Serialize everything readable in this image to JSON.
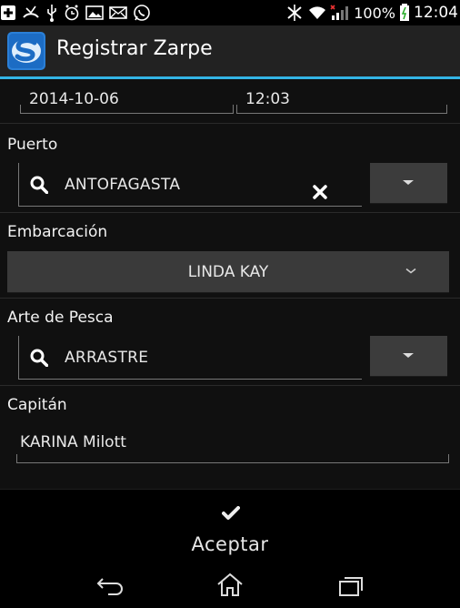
{
  "status_bar": {
    "battery_percent": "100%",
    "time": "12:04",
    "icons": [
      "app-notification-icon",
      "missed-call-icon",
      "usb-icon",
      "alarm-icon",
      "image-icon",
      "message-icon",
      "whatsapp-icon",
      "bluetooth-off-icon",
      "wifi-icon",
      "signal-icon",
      "battery-icon"
    ]
  },
  "action_bar": {
    "title": "Registrar Zarpe",
    "accent_color": "#33b5e5"
  },
  "form": {
    "date": "2014-10-06",
    "time": "12:03",
    "puerto": {
      "label": "Puerto",
      "value": "ANTOFAGASTA"
    },
    "embarcacion": {
      "label": "Embarcación",
      "value": "LINDA KAY"
    },
    "arte_de_pesca": {
      "label": "Arte de Pesca",
      "value": "ARRASTRE"
    },
    "capitan": {
      "label": "Capitán",
      "value": "KARINA Milott"
    }
  },
  "actions": {
    "accept_label": "Aceptar"
  },
  "nav_bar": {
    "buttons": [
      "back-icon",
      "home-icon",
      "recents-icon"
    ]
  }
}
